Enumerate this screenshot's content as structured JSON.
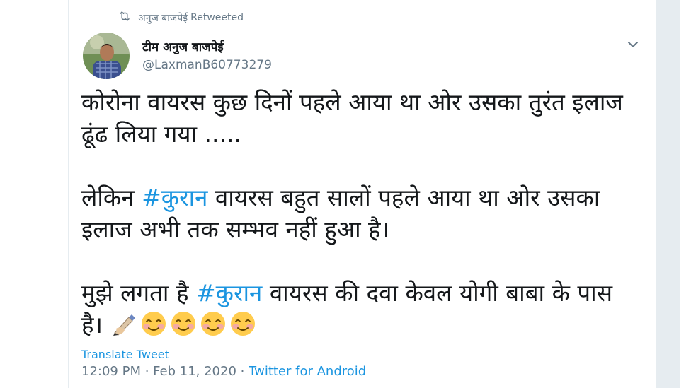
{
  "retweet": {
    "name": "अनुज बाजपेई",
    "label": "Retweeted"
  },
  "author": {
    "display_name": "टीम अनुज बाजपेई",
    "handle": "@LaxmanB60773279"
  },
  "tweet": {
    "line1": "कोरोना वायरस कुछ दिनों पहले आया था ओर उसका तुरंत इलाज",
    "line2": "ढूंढ लिया गया .....",
    "line3_pre": "लेकिन ",
    "hashtag": "#कुरान",
    "line3_post": " वायरस बहुत सालों पहले आया था ओर उसका",
    "line4": "इलाज अभी तक सम्भव नहीं हुआ है।",
    "line5_pre": "मुझे लगता है ",
    "line5_post": " वायरस की दवा केवल योगी बाबा के पास",
    "line6": "है। ",
    "emojis": [
      "writing-hand-icon",
      "smiling-face-icon",
      "smiling-face-icon",
      "smiling-face-icon",
      "smiling-face-icon"
    ]
  },
  "translate_label": "Translate Tweet",
  "meta": {
    "time": "12:09 PM",
    "separator": " · ",
    "date": "Feb 11, 2020",
    "source": "Twitter for Android"
  },
  "colors": {
    "link": "#1b95e0",
    "secondary": "#657786",
    "text": "#14171a"
  }
}
